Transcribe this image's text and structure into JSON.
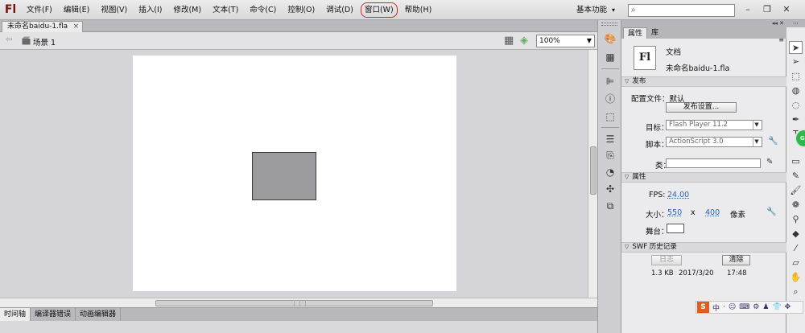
{
  "app": {
    "logo": "Fl"
  },
  "menu": [
    "文件(F)",
    "编辑(E)",
    "视图(V)",
    "插入(I)",
    "修改(M)",
    "文本(T)",
    "命令(C)",
    "控制(O)",
    "调试(D)",
    "窗口(W)",
    "帮助(H)"
  ],
  "menu_highlighted": "窗口(W)",
  "workspace": {
    "label": "基本功能",
    "arrow": "▾"
  },
  "search": {
    "value": "",
    "icon": "⌕"
  },
  "window_controls": {
    "minimize": "–",
    "restore": "❐",
    "close": "✕"
  },
  "doc_tab": {
    "label": "未命名baidu-1.fla",
    "close": "×"
  },
  "edit_bar": {
    "back": "⇦",
    "scene": "场景 1",
    "zoom": "100%"
  },
  "bottom_tabs": [
    "时间轴",
    "编译器错误",
    "动画编辑器"
  ],
  "props": {
    "tabs": [
      "属性",
      "库"
    ],
    "menu_icon": "≡",
    "doc_icon": "Fl",
    "doc_type": "文档",
    "doc_name": "未命名baidu-1.fla",
    "publish": {
      "heading": "发布",
      "profile_label": "配置文件：",
      "profile_value": "默认",
      "settings_button": "发布设置...",
      "target_label": "目标：",
      "target_value": "Flash Player 11.2",
      "script_label": "脚本：",
      "script_value": "ActionScript 3.0",
      "class_label": "类：",
      "class_value": ""
    },
    "properties": {
      "heading": "属性",
      "fps_label": "FPS:",
      "fps": "24.00",
      "size_label": "大小：",
      "width": "550",
      "x": "x",
      "height": "400",
      "unit": "像素",
      "stage_label": "舞台：",
      "stage_color": "#ffffff"
    },
    "swf_history": {
      "heading": "SWF 历史记录",
      "log_button": "日志",
      "clear_button": "清除",
      "entry": {
        "size": "1.3 KB",
        "date": "2017/3/20",
        "time": "17:48"
      }
    }
  },
  "ime": {
    "logo": "S",
    "items": [
      "中",
      "·",
      "☺",
      "⌨",
      "⚙",
      "♟",
      "👕",
      "✥"
    ]
  },
  "colors": {
    "accent_link": "#2e64b0",
    "circle_highlight": "#dd2222",
    "shape_fill": "#9b9a9c",
    "badge_green": "#2fb84c"
  }
}
